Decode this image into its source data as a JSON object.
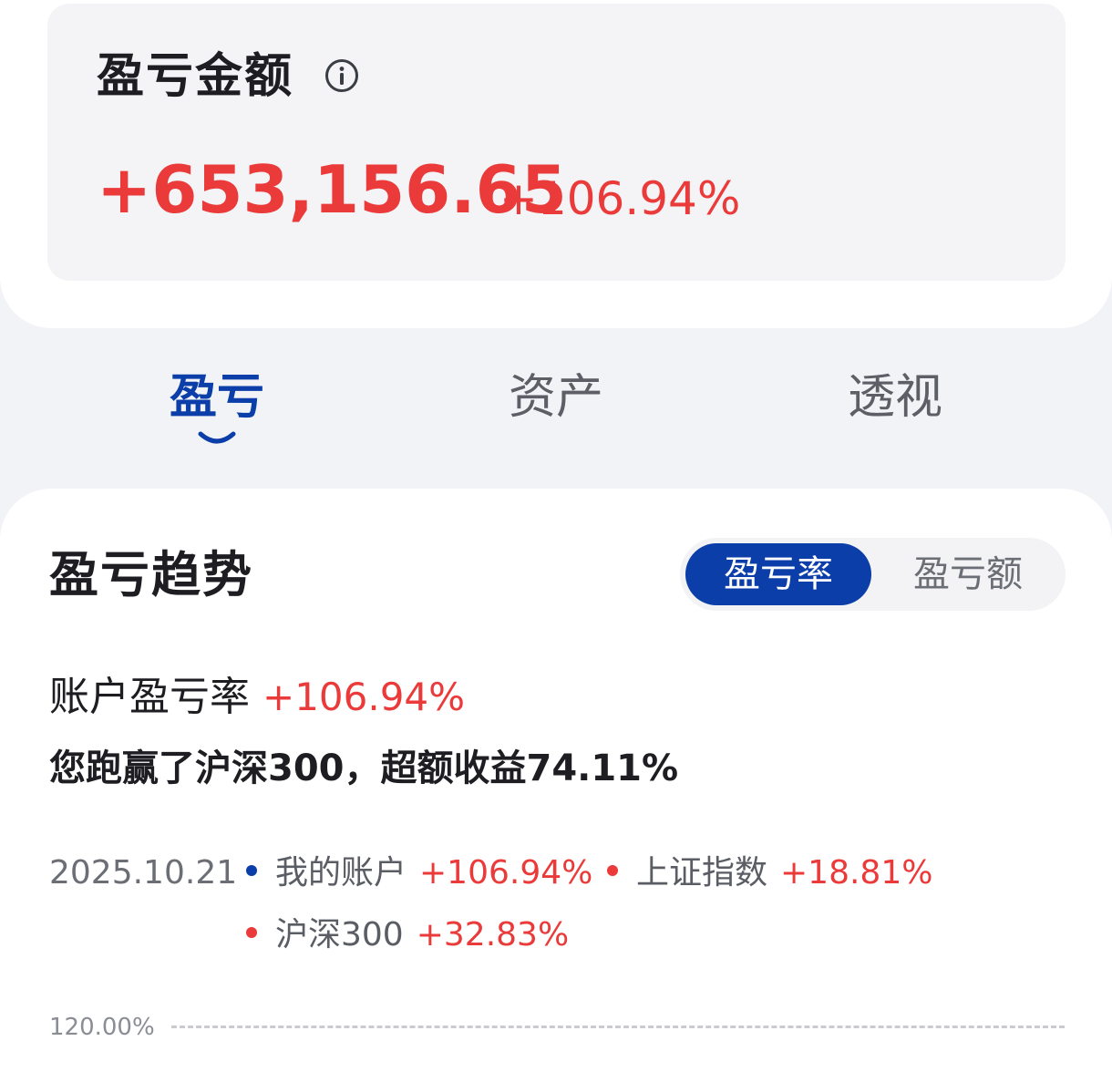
{
  "summary": {
    "title": "盈亏金额",
    "info_icon": "info-circle-icon",
    "amount": "+653,156.65",
    "percent": "+106.94%"
  },
  "tabs": [
    {
      "label": "盈亏",
      "active": true
    },
    {
      "label": "资产",
      "active": false
    },
    {
      "label": "透视",
      "active": false
    }
  ],
  "trend": {
    "title": "盈亏趋势",
    "toggle": {
      "rate_label": "盈亏率",
      "amount_label": "盈亏额",
      "selected": "盈亏率"
    },
    "account_rate_label": "账户盈亏率",
    "account_rate_value": "+106.94%",
    "beat_text": "您跑赢了沪深300，超额收益74.11%",
    "legend": {
      "date": "2025.10.21",
      "items": [
        {
          "name": "我的账户",
          "value": "+106.94%",
          "color": "#0b3ea8"
        },
        {
          "name": "上证指数",
          "value": "+18.81%",
          "color": "#ea3a3a"
        },
        {
          "name": "沪深300",
          "value": "+32.83%",
          "color": "#ea3a3a"
        }
      ]
    },
    "y_axis_top": "120.00%"
  },
  "colors": {
    "gain": "#ea3a3a",
    "accent": "#0b3ea8",
    "background": "#f2f3f6"
  }
}
